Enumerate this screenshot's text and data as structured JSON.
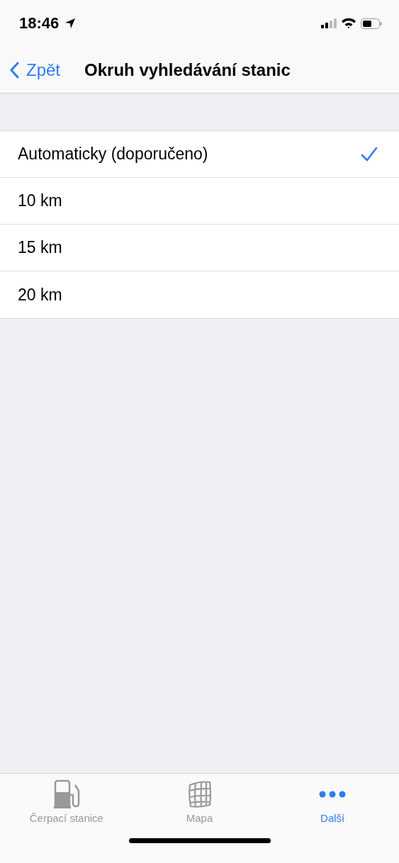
{
  "status_bar": {
    "time": "18:46"
  },
  "nav_bar": {
    "back": "Zpět",
    "title": "Okruh vyhledávání stanic"
  },
  "options": [
    {
      "label": "Automaticky (doporučeno)",
      "selected": true
    },
    {
      "label": "10 km",
      "selected": false
    },
    {
      "label": "15 km",
      "selected": false
    },
    {
      "label": "20 km",
      "selected": false
    }
  ],
  "tab_bar": [
    {
      "kind": "pump",
      "label": "Čerpací stanice",
      "selected": false
    },
    {
      "kind": "map",
      "label": "Mapa",
      "selected": false
    },
    {
      "kind": "more",
      "label": "Další",
      "selected": true
    }
  ]
}
